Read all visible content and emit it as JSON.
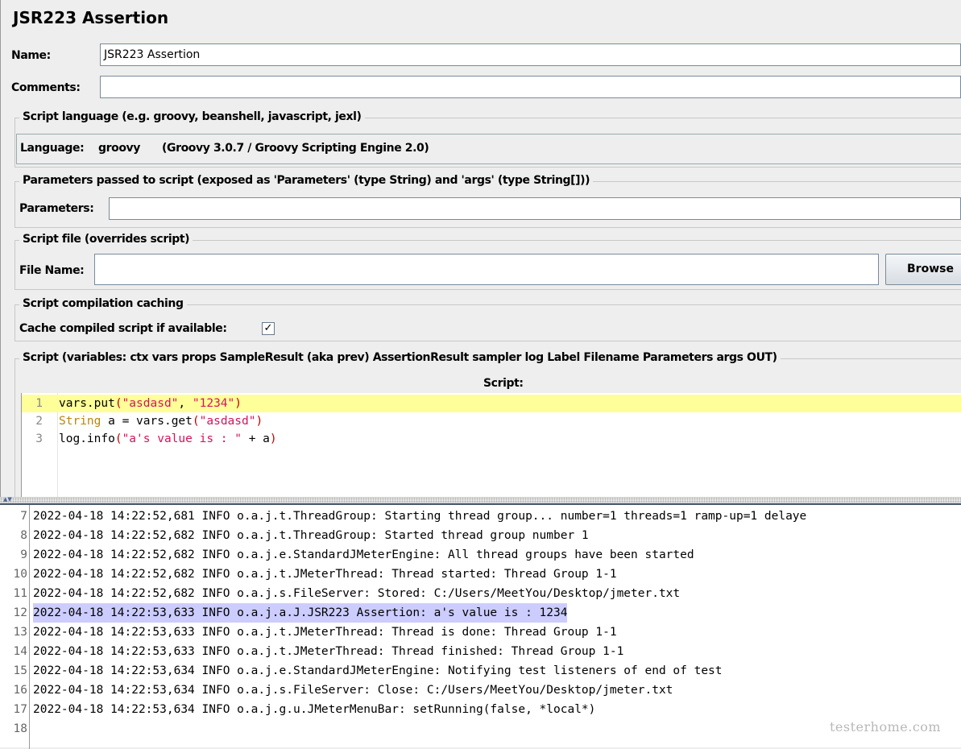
{
  "panel": {
    "title": "JSR223 Assertion",
    "name_label": "Name:",
    "name_value": "JSR223 Assertion",
    "comments_label": "Comments:",
    "comments_value": ""
  },
  "language_section": {
    "legend": "Script language (e.g. groovy, beanshell, javascript, jexl)",
    "label": "Language:",
    "value": "groovy",
    "engine": "(Groovy 3.0.7 / Groovy Scripting Engine 2.0)"
  },
  "parameters_section": {
    "legend": "Parameters passed to script (exposed as 'Parameters' (type String) and 'args' (type String[]))",
    "label": "Parameters:",
    "value": ""
  },
  "file_section": {
    "legend": "Script file (overrides script)",
    "label": "File Name:",
    "value": "",
    "browse_label": "Browse"
  },
  "caching_section": {
    "legend": "Script compilation caching",
    "label": "Cache compiled script if available:",
    "checked": true,
    "check_glyph": "✓"
  },
  "script_section": {
    "legend": "Script (variables: ctx vars props SampleResult (aka prev) AssertionResult sampler log Label Filename Parameters args OUT)",
    "header": "Script:",
    "lines": [
      {
        "num": "1",
        "parts": [
          [
            "plain",
            "vars.put"
          ],
          [
            "pn",
            "("
          ],
          [
            "str",
            "\"asdasd\""
          ],
          [
            "plain",
            ", "
          ],
          [
            "str",
            "\"1234\""
          ],
          [
            "pn",
            ")"
          ]
        ]
      },
      {
        "num": "2",
        "parts": [
          [
            "kw",
            "String"
          ],
          [
            "plain",
            " a = vars.get"
          ],
          [
            "pn",
            "("
          ],
          [
            "str",
            "\"asdasd\""
          ],
          [
            "pn",
            ")"
          ]
        ]
      },
      {
        "num": "3",
        "parts": [
          [
            "plain",
            "log.info"
          ],
          [
            "pn",
            "("
          ],
          [
            "str",
            "\"a's value is : \""
          ],
          [
            "plain",
            " + a"
          ],
          [
            "pn",
            ")"
          ]
        ]
      }
    ]
  },
  "log": {
    "lines": [
      {
        "num": "7",
        "text": "2022-04-18 14:22:52,681 INFO o.a.j.t.ThreadGroup: Starting thread group... number=1 threads=1 ramp-up=1 delaye"
      },
      {
        "num": "8",
        "text": "2022-04-18 14:22:52,682 INFO o.a.j.t.ThreadGroup: Started thread group number 1"
      },
      {
        "num": "9",
        "text": "2022-04-18 14:22:52,682 INFO o.a.j.e.StandardJMeterEngine: All thread groups have been started"
      },
      {
        "num": "10",
        "text": "2022-04-18 14:22:52,682 INFO o.a.j.t.JMeterThread: Thread started: Thread Group 1-1"
      },
      {
        "num": "11",
        "text": "2022-04-18 14:22:52,682 INFO o.a.j.s.FileServer: Stored: C:/Users/MeetYou/Desktop/jmeter.txt"
      },
      {
        "num": "12",
        "text": "2022-04-18 14:22:53,633 INFO o.a.j.a.J.JSR223 Assertion: a's value is : 1234",
        "highlight": true
      },
      {
        "num": "13",
        "text": "2022-04-18 14:22:53,633 INFO o.a.j.t.JMeterThread: Thread is done: Thread Group 1-1"
      },
      {
        "num": "14",
        "text": "2022-04-18 14:22:53,633 INFO o.a.j.t.JMeterThread: Thread finished: Thread Group 1-1"
      },
      {
        "num": "15",
        "text": "2022-04-18 14:22:53,634 INFO o.a.j.e.StandardJMeterEngine: Notifying test listeners of end of test"
      },
      {
        "num": "16",
        "text": "2022-04-18 14:22:53,634 INFO o.a.j.s.FileServer: Close: C:/Users/MeetYou/Desktop/jmeter.txt"
      },
      {
        "num": "17",
        "text": "2022-04-18 14:22:53,634 INFO o.a.j.g.u.JMeterMenuBar: setRunning(false, *local*)"
      },
      {
        "num": "18",
        "text": ""
      }
    ]
  },
  "watermark": "testerhome.com",
  "colors": {
    "highlight_line": "#ffff99",
    "log_highlight": "#ccccff",
    "keyword": "#b8860b",
    "string": "#d4145a",
    "paren": "#c00000"
  }
}
